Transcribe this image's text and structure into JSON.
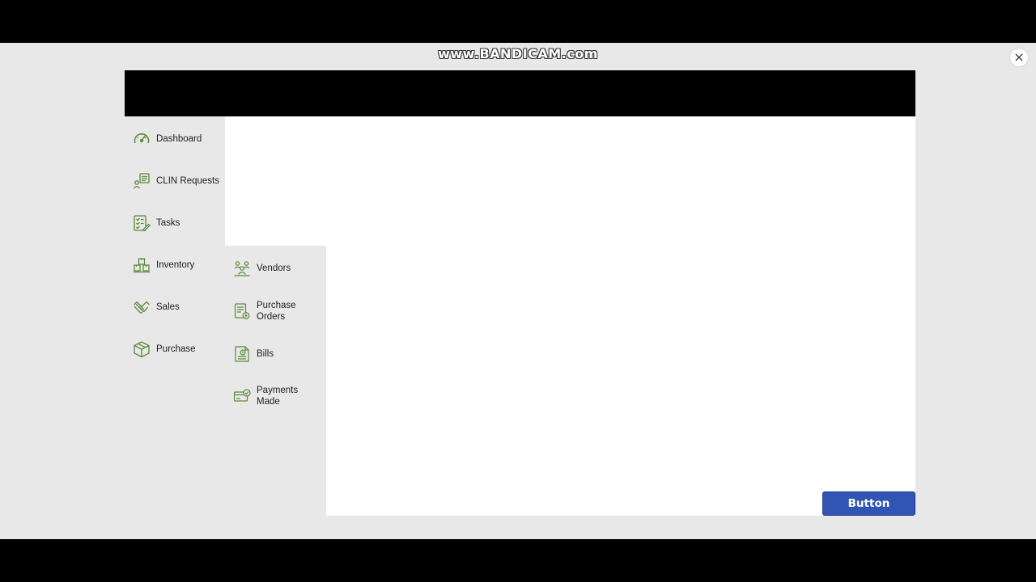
{
  "recorder": {
    "watermark": "www.BANDICAM.com"
  },
  "colors": {
    "icon_green": "#5a8a3a",
    "button_blue": "#3155b4",
    "panel_gray": "#e8e8e8"
  },
  "sidebar": {
    "items": [
      {
        "label": "Dashboard",
        "icon": "speedometer-icon"
      },
      {
        "label": "CLIN Requests",
        "icon": "request-list-icon"
      },
      {
        "label": "Tasks",
        "icon": "task-checklist-icon"
      },
      {
        "label": "Inventory",
        "icon": "boxes-icon"
      },
      {
        "label": "Sales",
        "icon": "handshake-icon"
      },
      {
        "label": "Purchase",
        "icon": "package-icon"
      }
    ]
  },
  "submenu": {
    "parent": "Purchase",
    "items": [
      {
        "label": "Vendors",
        "icon": "vendors-icon"
      },
      {
        "label": "Purchase Orders",
        "icon": "purchase-order-icon"
      },
      {
        "label": "Bills",
        "icon": "bill-icon"
      },
      {
        "label": "Payments Made",
        "icon": "payment-check-icon"
      }
    ]
  },
  "main": {
    "button_label": "Button"
  }
}
